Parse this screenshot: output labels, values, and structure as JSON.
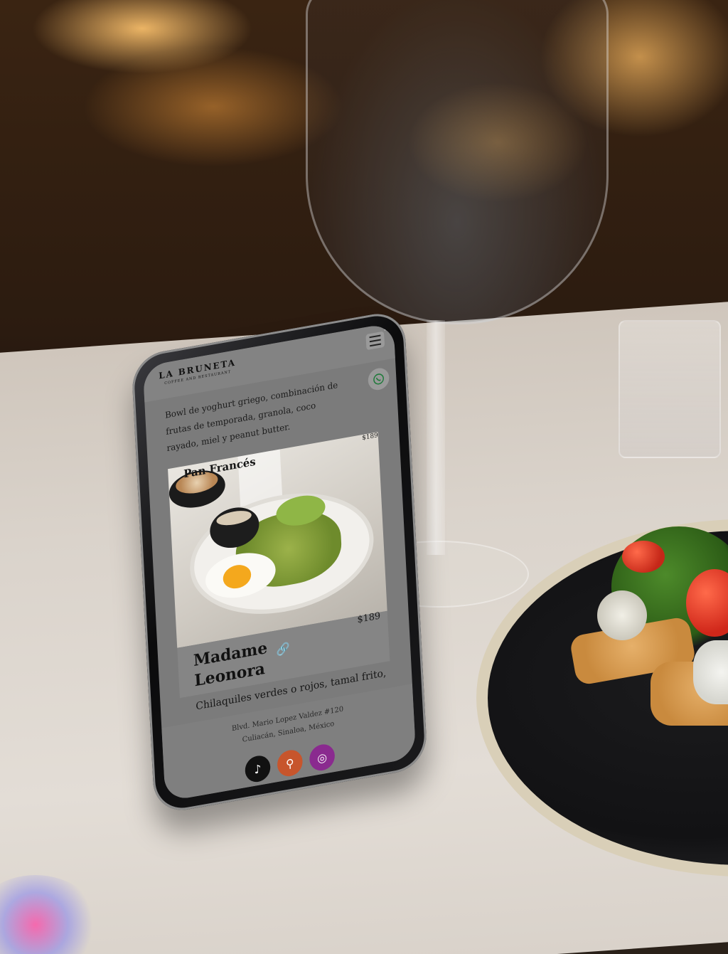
{
  "header": {
    "brand_name": "LA BRUNETA",
    "brand_tagline": "COFFEE AND RESTAURANT"
  },
  "menu_items": [
    {
      "title": "Pan Francés",
      "price": "$189",
      "description": "Bowl de yoghurt griego, combinación de frutas de temporada, granola, coco rayado, miel y peanut butter."
    },
    {
      "title": "Madame Leonora",
      "price": "$189",
      "description": "Chilaquiles verdes o rojos, tamal frito,"
    }
  ],
  "footer": {
    "address_line1": "Blvd. Mario Lopez Valdez #120",
    "address_line2": "Culiacán, Sinaloa, México"
  },
  "icons": {
    "menu": "hamburger-menu-icon",
    "whatsapp": "whatsapp-icon",
    "link": "link-icon",
    "tiktok": "tiktok-icon",
    "location": "location-pin-icon",
    "instagram": "instagram-icon"
  },
  "colors": {
    "tiktok": "#111111",
    "location": "#c7552c",
    "instagram": "#8a2a8f"
  }
}
